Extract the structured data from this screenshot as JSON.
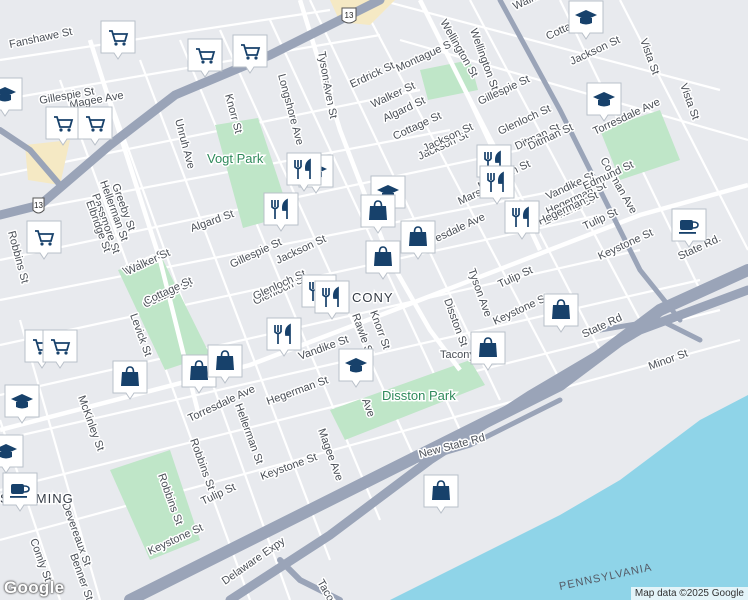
{
  "map": {
    "colors": {
      "land": "#e8eaee",
      "water": "#8fd4e8",
      "park": "#bfe6c8",
      "highway": "#9aa4b8",
      "arterial": "#ffffff",
      "marker": "#17416b",
      "sand": "#f5e9c4"
    },
    "parks": [
      {
        "name": "Vogt Park",
        "label_id": "vogt"
      },
      {
        "name": "Disston Park",
        "label_id": "disston"
      }
    ],
    "neighborhoods": [
      "CONY",
      "Tacony",
      "SINOMING"
    ],
    "state_label": "PENNSYLVANIA",
    "route_shield": "13",
    "streets": [
      "Fanshawe St",
      "Magee Ave",
      "Gillespie St",
      "Robbins St",
      "Greeby St",
      "Hellerman St",
      "Passmore St",
      "Elbridge St",
      "Unruh Ave",
      "Knorr St",
      "Longshore Ave",
      "Disston St",
      "Tyson Ave",
      "Erdrick St",
      "Montague St",
      "Wellington St",
      "Walker St",
      "Algard St",
      "Cottage St",
      "Gillespie St",
      "Glenloch St",
      "Ditman St",
      "Jackson St",
      "Torresdale Ave",
      "Cottman Ave",
      "Vista St",
      "Marsden St",
      "Vandike St",
      "Hegerman St",
      "Edmund St",
      "Tulip St",
      "Keystone St",
      "State Rd.",
      "State Rd",
      "Minor St",
      "New State Rd",
      "Delaware Expy",
      "Tacony",
      "Devereaux St",
      "Benner St",
      "Comly St",
      "McKinley St",
      "Levick St",
      "Robbins St",
      "Rawle St",
      "Magee Ave",
      "Keystone St",
      "Tulip St",
      "Keystone St",
      "Algard St",
      "Jackson St",
      "Gillespie St",
      "Walker St",
      "Cottage St",
      "Glenloch St",
      "Vandike St",
      "Torresdale Ave",
      "Hegerman St",
      "Hellerman St",
      "Robbins St",
      "Knorr St",
      "Disston St",
      "Tyson Ave",
      "Edmund St",
      "Hegerman St",
      "Tulip St",
      "Keystone St",
      "Walker St",
      "Cottage St",
      "Jackson St",
      "Glenloch St",
      "Ditman St",
      "Torresdale Ave",
      "Vista St",
      "Marsden St",
      "Wellington St",
      "Jackson St",
      "Cottage St",
      "Walker St",
      "Ave"
    ],
    "markers": [
      {
        "type": "grocery",
        "icon": "cart-icon"
      },
      {
        "type": "grocery",
        "icon": "cart-icon"
      },
      {
        "type": "grocery",
        "icon": "cart-icon"
      },
      {
        "type": "grocery",
        "icon": "cart-icon"
      },
      {
        "type": "grocery",
        "icon": "cart-icon"
      },
      {
        "type": "grocery",
        "icon": "cart-icon"
      },
      {
        "type": "grocery",
        "icon": "cart-icon"
      },
      {
        "type": "grocery",
        "icon": "cart-icon"
      },
      {
        "type": "school",
        "icon": "graduation-cap-icon"
      },
      {
        "type": "school",
        "icon": "graduation-cap-icon"
      },
      {
        "type": "school",
        "icon": "graduation-cap-icon"
      },
      {
        "type": "school",
        "icon": "graduation-cap-icon"
      },
      {
        "type": "school",
        "icon": "graduation-cap-icon"
      },
      {
        "type": "school",
        "icon": "graduation-cap-icon"
      },
      {
        "type": "school",
        "icon": "graduation-cap-icon"
      },
      {
        "type": "school",
        "icon": "graduation-cap-icon"
      },
      {
        "type": "restaurant",
        "icon": "fork-knife-icon"
      },
      {
        "type": "restaurant",
        "icon": "fork-knife-icon"
      },
      {
        "type": "restaurant",
        "icon": "fork-knife-icon"
      },
      {
        "type": "restaurant",
        "icon": "fork-knife-icon"
      },
      {
        "type": "restaurant",
        "icon": "fork-knife-icon"
      },
      {
        "type": "restaurant",
        "icon": "fork-knife-icon"
      },
      {
        "type": "restaurant",
        "icon": "fork-knife-icon"
      },
      {
        "type": "restaurant",
        "icon": "fork-knife-icon"
      },
      {
        "type": "shopping",
        "icon": "shopping-bag-icon"
      },
      {
        "type": "shopping",
        "icon": "shopping-bag-icon"
      },
      {
        "type": "shopping",
        "icon": "shopping-bag-icon"
      },
      {
        "type": "shopping",
        "icon": "shopping-bag-icon"
      },
      {
        "type": "shopping",
        "icon": "shopping-bag-icon"
      },
      {
        "type": "shopping",
        "icon": "shopping-bag-icon"
      },
      {
        "type": "shopping",
        "icon": "shopping-bag-icon"
      },
      {
        "type": "shopping",
        "icon": "shopping-bag-icon"
      },
      {
        "type": "shopping",
        "icon": "shopping-bag-icon"
      },
      {
        "type": "cafe",
        "icon": "coffee-cup-icon"
      },
      {
        "type": "cafe",
        "icon": "coffee-cup-icon"
      }
    ]
  },
  "attribution": "Map data ©2025 Google",
  "logo": "Google"
}
